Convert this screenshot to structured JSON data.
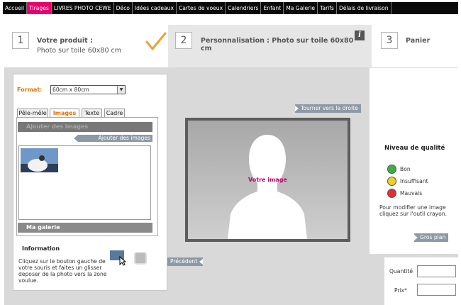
{
  "nav": {
    "items": [
      {
        "label": "Accueil",
        "active": false
      },
      {
        "label": "Tirages",
        "active": true
      },
      {
        "label": "LIVRES PHOTO CEWE",
        "active": false
      },
      {
        "label": "Déco",
        "active": false
      },
      {
        "label": "Idées cadeaux",
        "active": false
      },
      {
        "label": "Cartes de voeux",
        "active": false
      },
      {
        "label": "Calendriers",
        "active": false
      },
      {
        "label": "Enfant",
        "active": false
      },
      {
        "label": "Ma Galerie",
        "active": false
      },
      {
        "label": "Tarifs",
        "active": false
      },
      {
        "label": "Délais de livraison",
        "active": false
      }
    ],
    "active_color": "#e5006d"
  },
  "steps": {
    "step1": {
      "number": "1",
      "title": "Votre produit :",
      "subtitle": "Photo sur toile 60x80 cm"
    },
    "step2": {
      "number": "2",
      "title": "Personnalisation : Photo sur toile 60x80",
      "title_line2": "cm",
      "info_icon": "info-icon"
    },
    "step3": {
      "number": "3",
      "title": "Panier"
    }
  },
  "format": {
    "label": "Format:",
    "value": "60cm x 80cm"
  },
  "tabs": [
    {
      "label": "Pêle-mêle",
      "active": false
    },
    {
      "label": "Images",
      "active": true
    },
    {
      "label": "Texte",
      "active": false
    },
    {
      "label": "Cadre",
      "active": false
    }
  ],
  "images_panel": {
    "section_title": "Ajouter des images",
    "add_button": "Ajouter des images",
    "gallery_title": "Ma galerie"
  },
  "information": {
    "title": "Information",
    "text": "Cliquez sur le bouton gauche de votre souris et faites un glisser deposer de la photo vers la zone voulue."
  },
  "canvas": {
    "rotate_button": "Tourner vers la droite",
    "placeholder_label": "Votre image",
    "previous_button": "Précédent"
  },
  "quality": {
    "title": "Niveau de qualité",
    "levels": [
      {
        "label": "Bon",
        "color": "#3cb043"
      },
      {
        "label": "Insuffisant",
        "color": "#f2d022"
      },
      {
        "label": "Mauvais",
        "color": "#e23030"
      }
    ],
    "help": "Pour modifier une image cliquez sur l'outil crayon.",
    "zoom_button": "Gros plan"
  },
  "order": {
    "quantity_label": "Quantité",
    "price_label": "Prix*",
    "quantity_value": "",
    "price_value": ""
  }
}
